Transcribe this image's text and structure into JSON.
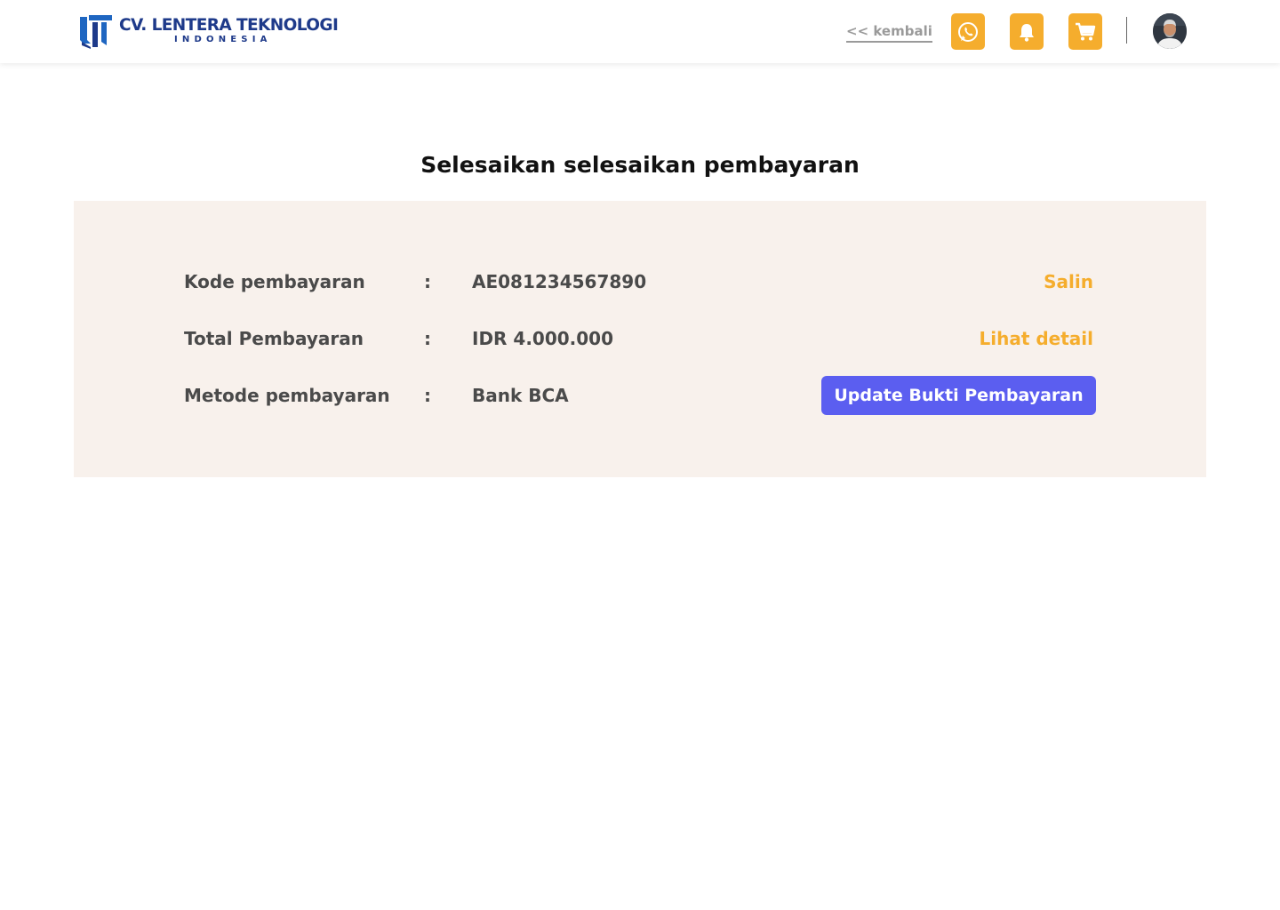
{
  "brand": {
    "name": "CV. LENTERA TEKNOLOGI",
    "subtitle": "INDONESIA",
    "primary_color": "#1e3a8a",
    "accent_color": "#f5ad2d"
  },
  "header": {
    "back_label": "<< kembali",
    "icons": [
      "whatsapp-icon",
      "bell-icon",
      "cart-icon"
    ]
  },
  "page": {
    "title": "Selesaikan selesaikan pembayaran"
  },
  "payment": {
    "rows": [
      {
        "label": "Kode pembayaran",
        "separator": ":",
        "value": "AE081234567890",
        "action": "Salin"
      },
      {
        "label": "Total Pembayaran",
        "separator": ":",
        "value": "IDR 4.000.000",
        "action": "Lihat detail"
      },
      {
        "label": "Metode pembayaran",
        "separator": ":",
        "value": "Bank BCA",
        "action": "Update Bukti Pembayaran"
      }
    ],
    "button_color": "#5b5ef0",
    "panel_color": "#f8f1ec"
  }
}
